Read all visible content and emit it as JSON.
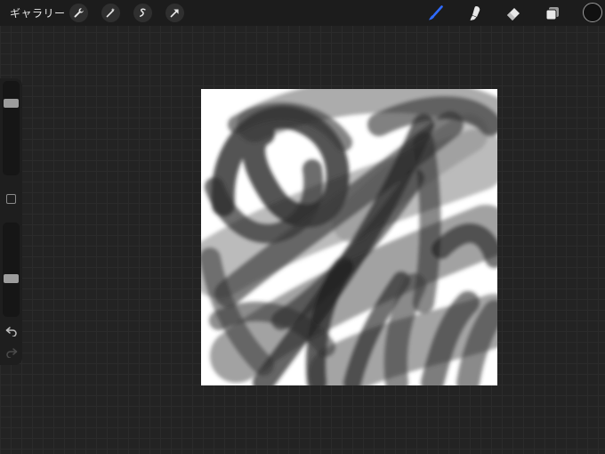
{
  "toolbar": {
    "gallery_label": "ギャラリー",
    "left_tools": [
      "wrench-icon",
      "magic-wand-icon",
      "selection-icon",
      "transform-arrow-icon"
    ],
    "right_tools": [
      "brush-icon",
      "smudge-icon",
      "eraser-icon",
      "layers-icon"
    ],
    "active_tool": "brush",
    "active_color": "#111111",
    "accent_color": "#2f6bff"
  },
  "sidebar": {
    "brush_size_level": 0.24,
    "opacity_level": 0.6,
    "icons": [
      "modify-square-icon",
      "undo-icon",
      "redo-icon"
    ]
  },
  "canvas": {
    "background_color": "#ffffff",
    "stroke_color": "#2a2a2a"
  }
}
